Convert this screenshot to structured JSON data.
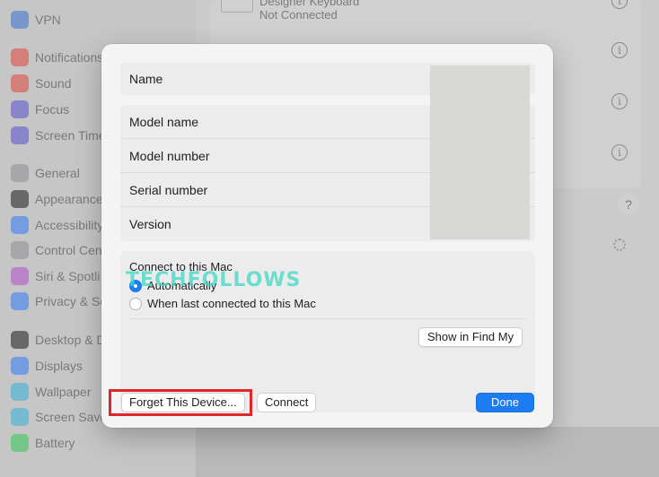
{
  "background": {
    "sidebar": [
      {
        "label": "VPN",
        "color": "#3b6fd4"
      },
      {
        "label": "Notifications",
        "color": "#e0453a"
      },
      {
        "label": "Sound",
        "color": "#e0453a"
      },
      {
        "label": "Focus",
        "color": "#5a4fcf"
      },
      {
        "label": "Screen Time",
        "color": "#5a4fcf"
      },
      {
        "label": "General",
        "color": "#8e8e93"
      },
      {
        "label": "Appearance",
        "color": "#1c1c1e"
      },
      {
        "label": "Accessibility",
        "color": "#2f7cf6"
      },
      {
        "label": "Control Cen",
        "color": "#8e8e93"
      },
      {
        "label": "Siri & Spotli",
        "color": "#b04fcf"
      },
      {
        "label": "Privacy & Se",
        "color": "#2f7cf6"
      },
      {
        "label": "Desktop & D",
        "color": "#1c1c1e"
      },
      {
        "label": "Displays",
        "color": "#2f7cf6"
      },
      {
        "label": "Wallpaper",
        "color": "#36b0d9"
      },
      {
        "label": "Screen Save",
        "color": "#36b0d9"
      },
      {
        "label": "Battery",
        "color": "#34c759"
      }
    ],
    "device_name": "Designer Keyboard",
    "device_status": "Not Connected",
    "info_glyph": "i",
    "help_glyph": "?"
  },
  "sheet": {
    "name_label": "Name",
    "model_name_label": "Model name",
    "model_number_label": "Model number",
    "serial_number_label": "Serial number",
    "version_label": "Version",
    "connect_title": "Connect to this Mac",
    "option_auto": "Automatically",
    "option_last": "When last connected to this Mac",
    "selected_option": "Automatically",
    "show_in_find_my": "Show in Find My",
    "forget_button": "Forget This Device...",
    "connect_button": "Connect",
    "done_button": "Done"
  },
  "watermark": "TECHFOLLOWS",
  "colors": {
    "accent": "#1e7cf2",
    "highlight": "#e0262a",
    "watermark": "#3fd9c4"
  }
}
